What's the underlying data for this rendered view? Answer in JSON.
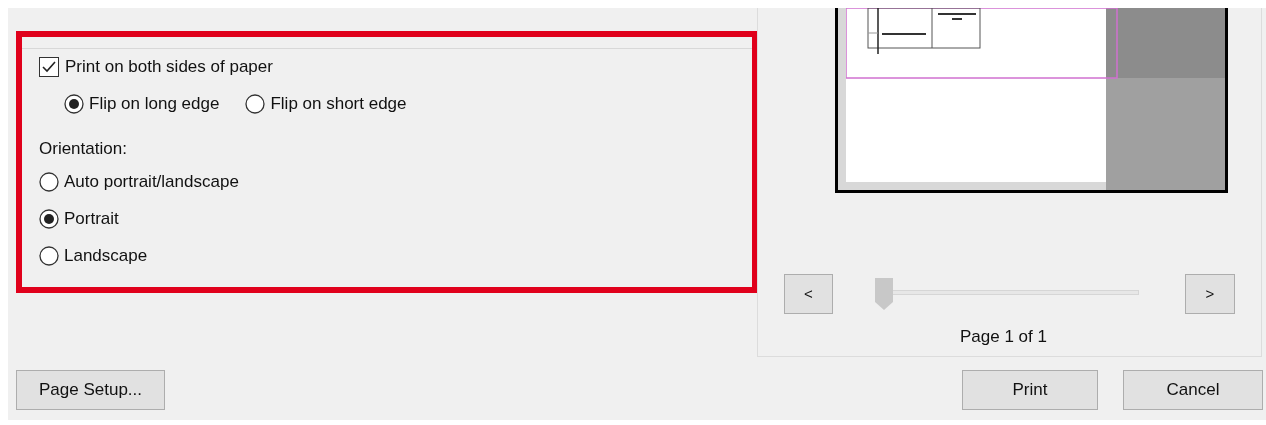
{
  "duplex": {
    "label": "Print on both sides of paper",
    "checked": true,
    "options": [
      {
        "label": "Flip on long edge",
        "selected": true
      },
      {
        "label": "Flip on short edge",
        "selected": false
      }
    ]
  },
  "orientation": {
    "label": "Orientation:",
    "options": [
      {
        "label": "Auto portrait/landscape",
        "selected": false
      },
      {
        "label": "Portrait",
        "selected": true
      },
      {
        "label": "Landscape",
        "selected": false
      }
    ]
  },
  "preview": {
    "prev_button": "<",
    "next_button": ">",
    "slider": {
      "level": 0
    },
    "page_label": "Page 1 of 1"
  },
  "buttons": {
    "page_setup": "Page Setup...",
    "print": "Print",
    "cancel": "Cancel"
  }
}
